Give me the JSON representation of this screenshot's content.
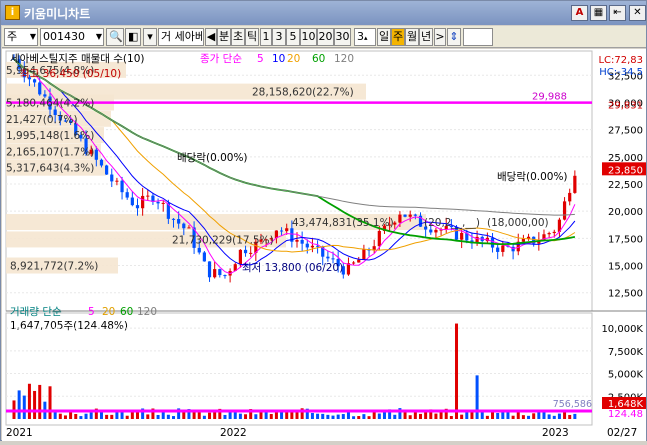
{
  "window": {
    "title": "키움미니차트"
  },
  "toolbar": {
    "market": "주",
    "code": "001430",
    "name": "세아베",
    "name_prefix": "거",
    "tabs": [
      "분",
      "초",
      "틱"
    ],
    "nums": [
      "1",
      "3",
      "5",
      "10",
      "20",
      "30"
    ],
    "period_input": "3",
    "periods": [
      "일",
      "주",
      "월",
      "년"
    ],
    "selected_period": "주"
  },
  "indicator_line": {
    "title": "세아베스틸지주 매물대 수(10)",
    "ma_label": "종가 단순",
    "ma_periods": [
      "5",
      "10",
      "20",
      "60",
      "120"
    ],
    "ma_colors": [
      "#ff00ff",
      "#0000ff",
      "#f0a000",
      "#00a000",
      "#808080"
    ]
  },
  "right_labels": {
    "lc": "LC:72,83",
    "hc": "HC:-34.5"
  },
  "chart_data": {
    "type": "line",
    "title": "세아베스틸지주 매물대 수(10)",
    "price_axis": [
      "32,500",
      "30,000",
      "27,500",
      "25,000",
      "22,500",
      "20,000",
      "17,500",
      "15,000",
      "12,500"
    ],
    "price_range": [
      11000,
      34000
    ],
    "current_price": "23,850",
    "current_price2": "29,831",
    "hline_value": "29,988",
    "max_label": "최고 36,450 (05/10)",
    "min_label": "최저 13,800 (06/20)",
    "dividend_labels": [
      "배당락(0.00%)",
      "배당락(0.00%)"
    ],
    "volume_profile": [
      {
        "label": "5,954,675(4.8%)",
        "price": 33000
      },
      {
        "label": "5,180,464(4.2%)",
        "price": 30000
      },
      {
        "label": "21,427(0.7%)",
        "price": 28500
      },
      {
        "label": "1,995,148(1.6%)",
        "price": 27000
      },
      {
        "label": "2,165,107(1.7%)",
        "price": 25500
      },
      {
        "label": "5,317,643(4.3%)",
        "price": 24000
      },
      {
        "label": "28,158,620(22.7%)",
        "price": 31000
      },
      {
        "label": "43,474,831(35.1%)",
        "price": 19000
      },
      {
        "label": "21,730,229(17.5%)",
        "price": 17400
      },
      {
        "label": "8,921,772(7.2%)",
        "price": 15000
      },
      {
        "label": "(20,2__,__)",
        "price": 19000
      },
      {
        "label": "(18,000,00)",
        "price": 19000
      }
    ],
    "x_labels": [
      "2021",
      "2022",
      "2023",
      "02/27"
    ]
  },
  "volume": {
    "title": "거래량 단순",
    "ma_periods": [
      "5",
      "20",
      "60",
      "120"
    ],
    "value_line": "1,647,705주(124.48%)",
    "axis": [
      "10,000K",
      "7,500K",
      "5,000K",
      "2,500K"
    ],
    "current": "1,648K",
    "ma_value": "756,586",
    "ratio": "124.48"
  }
}
